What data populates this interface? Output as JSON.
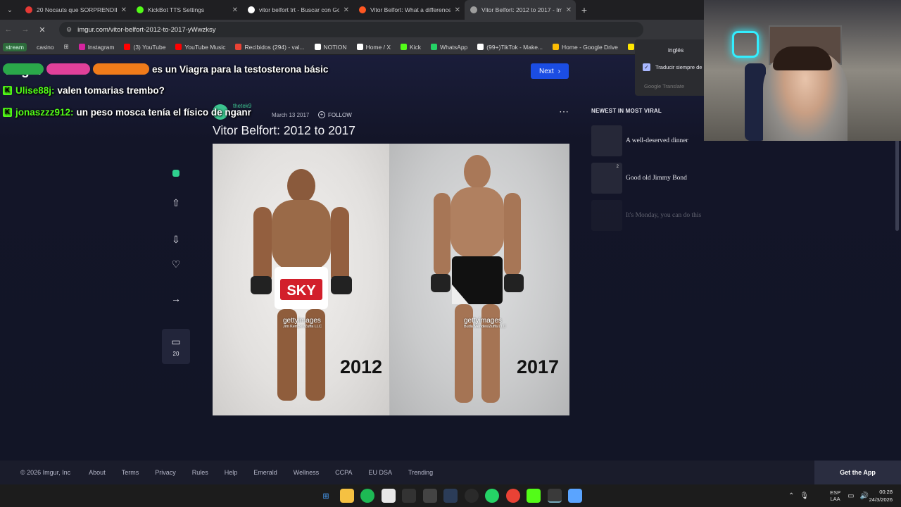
{
  "browser": {
    "tabs": [
      {
        "title": "20 Nocauts que SORPRENDIERON",
        "color": "#e53935",
        "active": false
      },
      {
        "title": "KickBot TTS Settings",
        "color": "#53fc18",
        "active": false
      },
      {
        "title": "vitor belfort trt - Buscar con Google",
        "color": "#ffffff",
        "active": false
      },
      {
        "title": "Vitor Belfort: What a difference",
        "color": "#ff5722",
        "active": false
      },
      {
        "title": "Vitor Belfort: 2012 to 2017 - Imgur",
        "color": "#9e9e9e",
        "active": true
      }
    ],
    "url": "imgur.com/vitor-belfort-2012-to-2017-yWwzksy",
    "bookmarks": [
      {
        "label": "stream",
        "color": "#2d6b3b"
      },
      {
        "label": "casino",
        "color": "#35363a"
      },
      {
        "label": "Instagram",
        "color": "#d6249f"
      },
      {
        "label": "(3) YouTube",
        "color": "#ff0000"
      },
      {
        "label": "YouTube Music",
        "color": "#ff0000"
      },
      {
        "label": "Recibidos (294) - val...",
        "color": "#ea4335"
      },
      {
        "label": "NOTION",
        "color": "#ffffff"
      },
      {
        "label": "Home / X",
        "color": "#ffffff"
      },
      {
        "label": "Kick",
        "color": "#53fc18"
      },
      {
        "label": "WhatsApp",
        "color": "#25d366"
      },
      {
        "label": "(99+)TikTok - Make...",
        "color": "#ffffff"
      },
      {
        "label": "Home - Google Drive",
        "color": "#fbbc04"
      },
      {
        "label": "Mercado Li",
        "color": "#ffe600"
      }
    ]
  },
  "post": {
    "next_label": "Next",
    "author": "thetek9",
    "date": "March 13 2017",
    "follow_label": "FOLLOW",
    "title": "Vitor Belfort: 2012 to 2017",
    "image": {
      "left_year": "2012",
      "right_year": "2017",
      "watermark": "gettyimages",
      "left_credit": "Jim Kemper/Zuffa LLC",
      "right_credit": "Buda Mendes/Zuffa LLC"
    },
    "comments_count": "20"
  },
  "sidebar": {
    "heading": "NEWEST IN MOST VIRAL",
    "items": [
      {
        "title": "A well-deserved dinner",
        "badge": ""
      },
      {
        "title": "Good old Jimmy Bond",
        "badge": "2"
      },
      {
        "title": "It's Monday, you can do this",
        "badge": ""
      }
    ]
  },
  "footer": {
    "copyright": "© 2026 Imgur, Inc",
    "links": [
      "About",
      "Terms",
      "Privacy",
      "Rules",
      "Help",
      "Emerald",
      "Wellness",
      "CCPA",
      "EU DSA",
      "Trending"
    ],
    "get_app": "Get the App"
  },
  "chat": [
    {
      "user": "",
      "message": "es un Viagra para la testosterona básic"
    },
    {
      "user": "Ulise88j:",
      "message": "valen tomarias trembo?"
    },
    {
      "user": "jonaszzz912:",
      "message": "un peso mosca tenía el físico de nganr"
    }
  ],
  "translate_popup": {
    "language": "inglés",
    "checkbox_label": "Traducir siempre de",
    "brand": "Google Translate"
  },
  "taskbar": {
    "lang": "ESP",
    "lang_sub": "LAA",
    "time": "00:28",
    "date": "24/3/2026"
  }
}
